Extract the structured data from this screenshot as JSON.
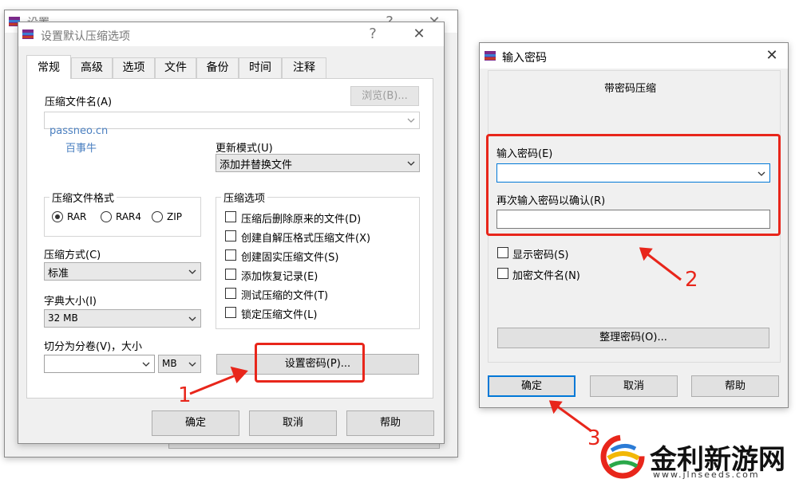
{
  "bg_window": {
    "title": "设置",
    "help": "?",
    "close": "✕"
  },
  "main_dialog": {
    "title": "设置默认压缩选项",
    "help": "?",
    "close": "✕",
    "tabs": [
      "常规",
      "高级",
      "选项",
      "文件",
      "备份",
      "时间",
      "注释"
    ],
    "archive_name_label": "压缩文件名(A)",
    "browse_button": "浏览(B)...",
    "archive_name_value": "",
    "watermark_line1": "passneo.cn",
    "watermark_line2": "百事牛",
    "update_mode_label": "更新模式(U)",
    "update_mode_value": "添加并替换文件",
    "format_group_label": "压缩文件格式",
    "format_options": [
      "RAR",
      "RAR4",
      "ZIP"
    ],
    "format_selected": "RAR",
    "options_group_label": "压缩选项",
    "options": [
      "压缩后删除原来的文件(D)",
      "创建自解压格式压缩文件(X)",
      "创建固实压缩文件(S)",
      "添加恢复记录(E)",
      "测试压缩的文件(T)",
      "锁定压缩文件(L)"
    ],
    "method_label": "压缩方式(C)",
    "method_value": "标准",
    "dict_label": "字典大小(I)",
    "dict_value": "32 MB",
    "split_label": "切分为分卷(V)，大小",
    "split_unit": "MB",
    "set_password_button": "设置密码(P)...",
    "ok": "确定",
    "cancel": "取消",
    "help_button": "帮助"
  },
  "password_dialog": {
    "title": "输入密码",
    "close": "✕",
    "subtitle": "带密码压缩",
    "enter_label": "输入密码(E)",
    "confirm_label": "再次输入密码以确认(R)",
    "show_password": "显示密码(S)",
    "encrypt_names": "加密文件名(N)",
    "organize_button": "整理密码(O)...",
    "ok": "确定",
    "cancel": "取消",
    "help_button": "帮助"
  },
  "annotations": [
    "1",
    "2",
    "3"
  ],
  "logo": {
    "text": "金利新游网",
    "url": "www.jlnseeds.com"
  },
  "colors": {
    "highlight": "#e8261b",
    "focus": "#0078d7"
  }
}
